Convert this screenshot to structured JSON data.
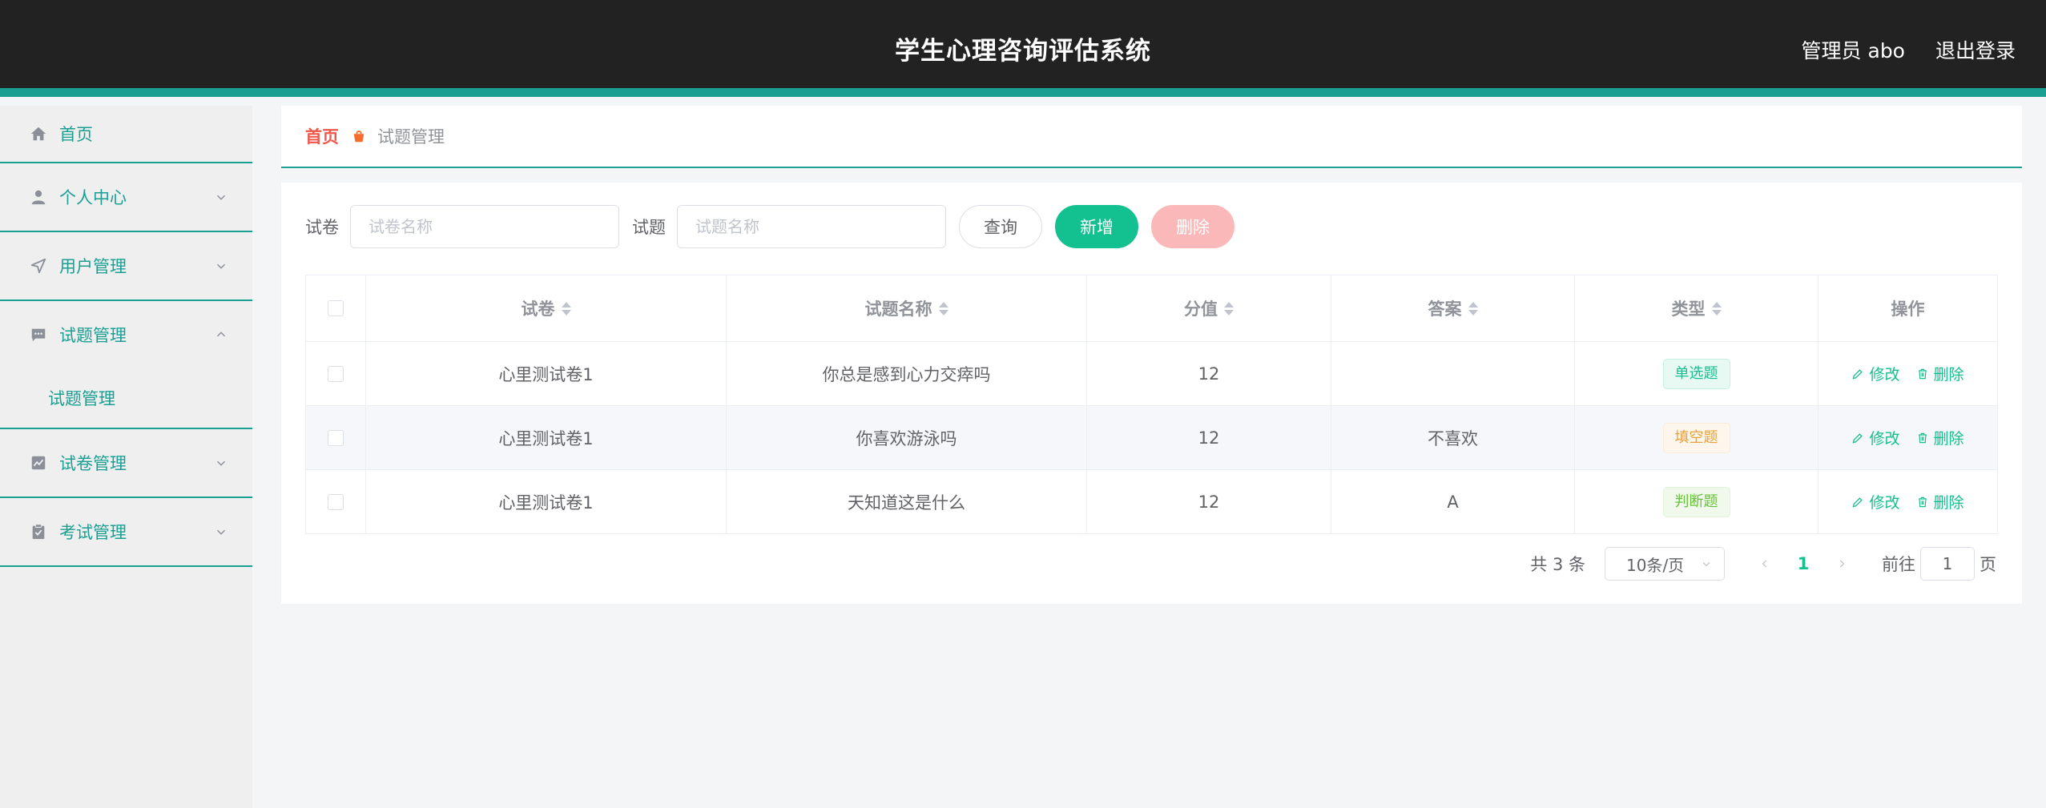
{
  "header": {
    "title": "学生心理咨询评估系统",
    "user_label": "管理员 abo",
    "logout_label": "退出登录"
  },
  "sidebar": {
    "items": [
      {
        "label": "首页",
        "icon": "home-icon"
      },
      {
        "label": "个人中心",
        "icon": "user-icon"
      },
      {
        "label": "用户管理",
        "icon": "send-icon"
      },
      {
        "label": "试题管理",
        "icon": "chat-icon",
        "expanded": true,
        "children": [
          {
            "label": "试题管理"
          }
        ]
      },
      {
        "label": "试卷管理",
        "icon": "chart-icon"
      },
      {
        "label": "考试管理",
        "icon": "clipboard-icon"
      }
    ]
  },
  "breadcrumb": {
    "home": "首页",
    "current": "试题管理"
  },
  "search": {
    "paper_label": "试卷",
    "paper_placeholder": "试卷名称",
    "question_label": "试题",
    "question_placeholder": "试题名称",
    "query_button": "查询",
    "add_button": "新增",
    "delete_button": "删除"
  },
  "table": {
    "columns": [
      "试卷",
      "试题名称",
      "分值",
      "答案",
      "类型",
      "操作"
    ],
    "rows": [
      {
        "paper": "心里测试卷1",
        "question": "你总是感到心力交瘁吗",
        "score": "12",
        "answer": "",
        "type": "单选题",
        "type_style": "single"
      },
      {
        "paper": "心里测试卷1",
        "question": "你喜欢游泳吗",
        "score": "12",
        "answer": "不喜欢",
        "type": "填空题",
        "type_style": "fill"
      },
      {
        "paper": "心里测试卷1",
        "question": "天知道这是什么",
        "score": "12",
        "answer": "A",
        "type": "判断题",
        "type_style": "judge"
      }
    ],
    "edit_label": "修改",
    "delete_label": "删除"
  },
  "pagination": {
    "total": "共 3 条",
    "page_size": "10条/页",
    "current_page": "1",
    "goto_prefix": "前往",
    "goto_value": "1",
    "goto_suffix": "页"
  },
  "colors": {
    "header_bg": "#222222",
    "accent": "#1a9f92",
    "primary": "#13c08f",
    "danger_light": "#fbb8b8",
    "breadcrumb_home": "#f0574a"
  }
}
